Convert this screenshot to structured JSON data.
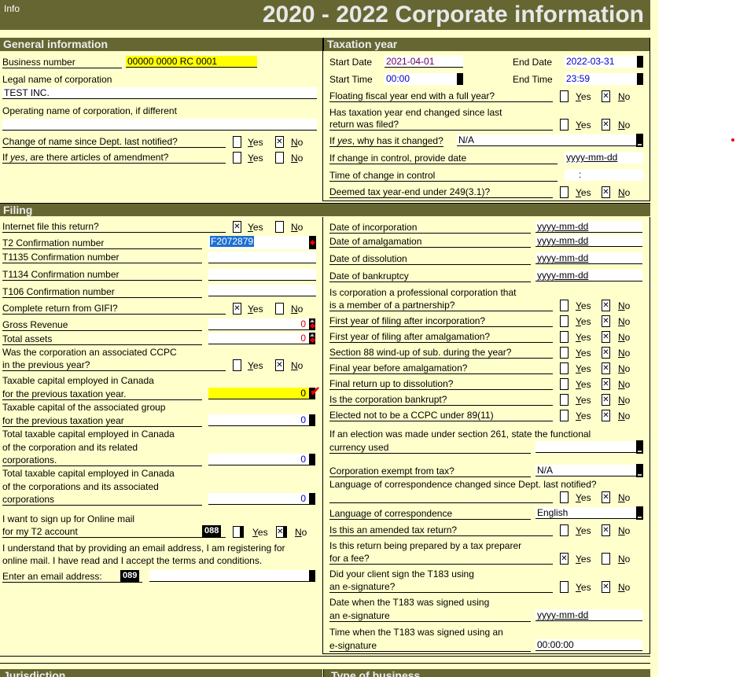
{
  "header": {
    "info": "Info",
    "title": "2020 - 2022 Corporate information"
  },
  "general": {
    "heading": "General information",
    "business_number_label": "Business number",
    "business_number": "00000 0000 RC 0001",
    "legal_name_label": "Legal name of corporation",
    "legal_name": "TEST INC.",
    "operating_name_label": "Operating name of corporation, if different",
    "operating_name": "",
    "name_change_label": "Change of name since Dept. last notified?",
    "amendment_label_pre": "If ",
    "amendment_label_em": "yes",
    "amendment_label_post": ", are there articles of amendment?",
    "yes": "Yes",
    "no": "No"
  },
  "taxation": {
    "heading": "Taxation year",
    "start_date_label": "Start Date",
    "start_date": "2021-04-01",
    "end_date_label": "End Date",
    "end_date": "2022-03-31",
    "start_time_label": "Start Time",
    "start_time": "00:00",
    "end_time_label": "End Time",
    "end_time": "23:59",
    "floating_label": "Floating fiscal year end with a full year?",
    "changed_label_1": "Has taxation year end changed since last",
    "changed_label_2": "return was filed?",
    "why_label_pre": "If ",
    "why_label_em": "yes",
    "why_label_post": ", why has it changed?",
    "why_value": "N/A",
    "control_date_label": "If change in control, provide date",
    "control_date": "yyyy-mm-dd",
    "control_time_label": "Time of change in control",
    "control_time": ":",
    "deemed_label": "Deemed tax year-end under 249(3.1)?"
  },
  "filing": {
    "heading": "Filing",
    "internet_label": "Internet file this return?",
    "t2_conf_label": "T2 Confirmation number",
    "t2_conf": "F2072879",
    "t1135_label": "T1135 Confirmation number",
    "t1134_label": "T1134 Confirmation number",
    "t106_label": "T106 Confirmation number",
    "gifi_label": "Complete return from GIFI?",
    "gross_revenue_label": "Gross Revenue",
    "gross_revenue": "0",
    "total_assets_label": "Total assets",
    "total_assets": "0",
    "assoc_label_1": "Was the corporation an associated CCPC",
    "assoc_label_2": "in the previous year?",
    "tc_prev_1": "Taxable capital employed in Canada",
    "tc_prev_2": "for the previous taxation year.",
    "tc_prev": "0",
    "tc_group_1": "Taxable capital of the associated group",
    "tc_group_2": "for the previous taxation year",
    "tc_group": "0",
    "tc_related_1": "Total taxable capital employed in Canada",
    "tc_related_2": "of the corporation and its related",
    "tc_related_3": "corporations.",
    "tc_related": "0",
    "tc_assoc_1": "Total taxable capital employed in Canada",
    "tc_assoc_2": "of the corporations and its associated",
    "tc_assoc_3": "corporations",
    "tc_assoc": "0",
    "online_mail_1": "I want to sign up for Online mail",
    "online_mail_2": "for my T2 account",
    "online_mail_code": "088",
    "consent_1": "I understand that by providing an email address, I am registering for",
    "consent_2": "online mail. I have read and I accept the terms and conditions.",
    "email_label": "Enter an email address:",
    "email_code": "089",
    "email": "",
    "inc_date_label": "Date of incorporation",
    "inc_date": "yyyy-mm-dd",
    "amal_date_label": "Date of amalgamation",
    "amal_date": "yyyy-mm-dd",
    "diss_date_label": "Date of dissolution",
    "diss_date": "yyyy-mm-dd",
    "bank_date_label": "Date of bankruptcy",
    "bank_date": "yyyy-mm-dd",
    "prof_1": "Is corporation a professional corporation that",
    "prof_2": "is a member of a partnership?",
    "first_inc": "First year of filing after incorporation?",
    "first_amal": "First year of filing after amalgamation?",
    "sec88": "Section 88 wind-up of sub. during the year?",
    "final_amal": "Final year before amalgamation?",
    "final_diss": "Final return up to dissolution?",
    "bankrupt": "Is the corporation bankrupt?",
    "elected": "Elected not to be a CCPC under 89(11)",
    "currency_1": "If an election was made under section 261, state the functional",
    "currency_2": "currency used",
    "currency": "",
    "exempt_label": "Corporation exempt from tax?",
    "exempt": "N/A",
    "lang_changed": "Language of correspondence changed since Dept. last notified?",
    "lang_label": "Language of correspondence",
    "lang": "English",
    "amended": "Is this an amended tax return?",
    "preparer_1": "Is this return being prepared by a tax preparer",
    "preparer_2": "for a fee?",
    "esig_1": "Did your client sign the T183 using",
    "esig_2": "an e-signature?",
    "esig_date_1": "Date when the T183 was signed using",
    "esig_date_2": "an e-signature",
    "esig_date": "yyyy-mm-dd",
    "esig_time_1": "Time when the T183 was signed using an",
    "esig_time_2": "e-signature",
    "esig_time": "00:00:00"
  },
  "footer": {
    "jurisdiction": "Jurisdiction",
    "type_of_business": "Type of business"
  },
  "checkboxes": {
    "name_change": "no",
    "amendment": "none",
    "floating": "no",
    "changed": "no",
    "deemed": "no",
    "internet": "yes",
    "gifi": "yes",
    "assoc": "no",
    "online_mail": "no",
    "prof": "no",
    "first_inc": "no",
    "first_amal": "no",
    "sec88": "no",
    "final_amal": "no",
    "final_diss": "no",
    "bankrupt": "no",
    "elected": "no",
    "lang_changed": "no",
    "amended": "no",
    "preparer": "yes",
    "esig": "no"
  }
}
